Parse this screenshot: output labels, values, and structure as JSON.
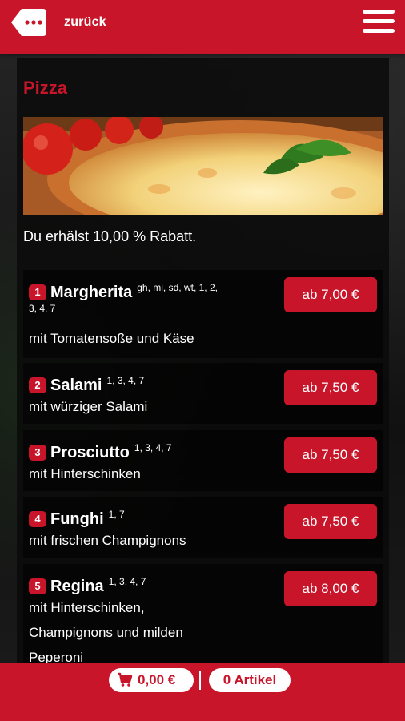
{
  "header": {
    "back_label": "zurück"
  },
  "category": {
    "title": "Pizza",
    "discount_text": "Du erhälst 10,00 % Rabatt."
  },
  "items": [
    {
      "number": "1",
      "name": "Margherita",
      "allergens": "gh, mi, sd, wt, 1, 2, 3, 4, 7",
      "allergens_line1": "gh, mi, sd, wt, 1, 2,",
      "allergens_line2": "3, 4, 7",
      "description": "mit Tomatensoße und Käse",
      "price": "ab 7,00 €"
    },
    {
      "number": "2",
      "name": "Salami",
      "allergens": "1, 3, 4, 7",
      "description": "mit würziger Salami",
      "price": "ab 7,50 €"
    },
    {
      "number": "3",
      "name": "Prosciutto",
      "allergens": "1, 3, 4, 7",
      "description": "mit Hinterschinken",
      "price": "ab 7,50 €"
    },
    {
      "number": "4",
      "name": "Funghi",
      "allergens": "1, 7",
      "description": "mit frischen Champignons",
      "price": "ab 7,50 €"
    },
    {
      "number": "5",
      "name": "Regina",
      "allergens": "1, 3, 4, 7",
      "description_line1": "mit Hinterschinken,",
      "description_line2": "Champignons und milden",
      "description_line3": "Peperoni",
      "price": "ab 8,00 €"
    }
  ],
  "footer": {
    "cart_total": "0,00 €",
    "article_count": "0 Artikel"
  },
  "colors": {
    "brand_red": "#c8152a",
    "panel_bg": "#0a0a0a",
    "text": "#ffffff"
  },
  "icons": {
    "back": "back-arrow-tag-icon",
    "menu": "hamburger-menu-icon",
    "cart": "shopping-cart-icon"
  }
}
